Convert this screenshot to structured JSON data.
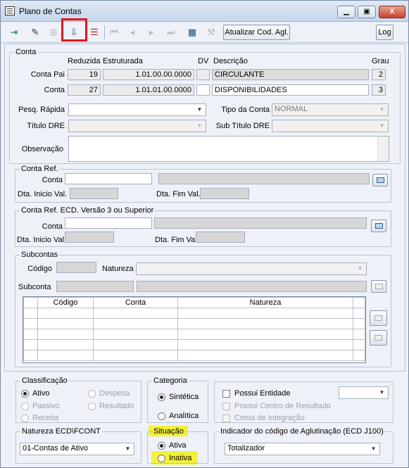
{
  "window": {
    "title": "Plano de Contas",
    "min": "▁",
    "max": "▣",
    "close": "X"
  },
  "toolbar": {
    "icons": [
      "exit-icon",
      "eraser-icon",
      "tree-icon",
      "download-icon",
      "toolbar-stack-icon",
      "first-icon",
      "prev-icon",
      "next-icon",
      "last-icon",
      "grid-icon",
      "tool-icon"
    ],
    "atualizar_label": "Atualizar Cod. Agl.",
    "log_label": "Log"
  },
  "conta": {
    "legend": "Conta",
    "h_reduzida": "Reduzida",
    "h_estruturada": "Estruturada",
    "h_dv": "DV",
    "h_descricao": "Descrição",
    "h_grau": "Grau",
    "pai_label": "Conta Pai",
    "pai_reduzida": "19",
    "pai_estruturada": "1.01.00.00.0000",
    "pai_dv": "",
    "pai_descricao": "CIRCULANTE",
    "pai_grau": "2",
    "conta_label": "Conta",
    "conta_reduzida": "27",
    "conta_estruturada": "1.01.01.00.0000",
    "conta_dv": "",
    "conta_descricao": "DISPONIBILIDADES",
    "conta_grau": "3",
    "pesq_label": "Pesq. Rápida",
    "pesq_value": "",
    "tipo_label": "Tipo da Conta",
    "tipo_value": "NORMAL",
    "titulo_dre_label": "Título DRE",
    "titulo_dre_value": "",
    "sub_titulo_dre_label": "Sub Título DRE",
    "sub_titulo_dre_value": "",
    "observacao_label": "Observação"
  },
  "conta_ref": {
    "legend": "Conta Ref.",
    "conta_label": "Conta",
    "dta_inicio_label": "Dta. Inicio Val.",
    "dta_fim_label": "Dta. Fim Val."
  },
  "conta_ref_ecd": {
    "legend": "Conta Ref. ECD. Versão 3 ou Superior",
    "conta_label": "Conta",
    "dta_inicio_label": "Dta. Inicio Val",
    "dta_fim_label": "Dta. Fim Val"
  },
  "subcontas": {
    "legend": "Subcontas",
    "codigo_label": "Código",
    "natureza_label": "Natureza",
    "subconta_label": "Subconta",
    "columns": [
      "Código",
      "Conta",
      "Natureza"
    ],
    "rows": [
      [
        "",
        "",
        ""
      ],
      [
        "",
        "",
        ""
      ],
      [
        "",
        "",
        ""
      ],
      [
        "",
        "",
        ""
      ],
      [
        "",
        "",
        ""
      ]
    ]
  },
  "classificacao": {
    "legend": "Classificação",
    "options": [
      "Ativo",
      "Despesa",
      "Passivo",
      "Resultado",
      "Receita"
    ],
    "selected": "Ativo"
  },
  "categoria": {
    "legend": "Categoria",
    "options": [
      "Sintética",
      "Analítica"
    ],
    "selected": "Sintética"
  },
  "entidade": {
    "possui_entidade_label": "Possui Entidade",
    "possui_centro_label": "Possui Centro de Resultado",
    "conta_integracao_label": "Conta de Integração",
    "entidade_value": ""
  },
  "natureza_ecd": {
    "legend": "Natureza ECD\\FCONT",
    "value": "01-Contas de Ativo"
  },
  "situacao": {
    "legend": "Situação",
    "options": [
      "Ativa",
      "Inativa"
    ],
    "selected": "Ativa"
  },
  "indicador": {
    "legend": "Indicador do código de Aglutinação (ECD J100)",
    "value": "Totalizador"
  },
  "colors": {
    "highlight_red": "#e3151b",
    "highlight_yellow": "#f3f03a",
    "window_bg": "#eef2f8"
  }
}
